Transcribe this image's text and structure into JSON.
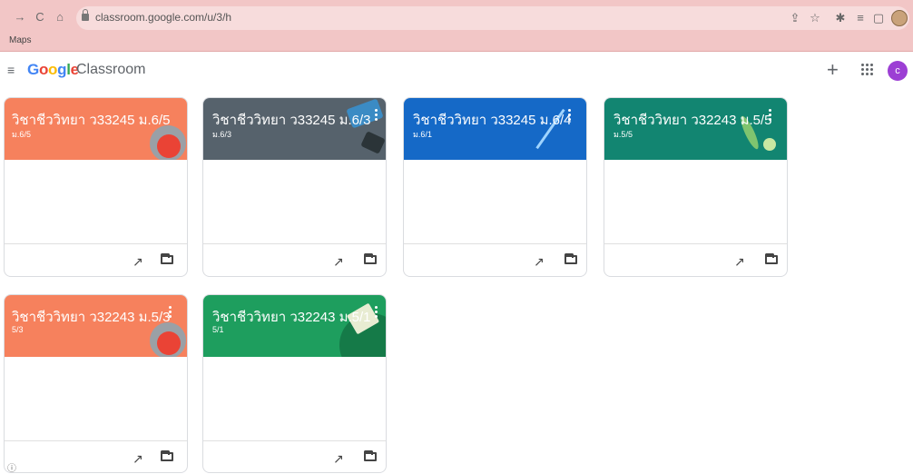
{
  "browser": {
    "url": "classroom.google.com/u/3/h",
    "bookmark": "Maps"
  },
  "app": {
    "logo_parts": [
      "G",
      "o",
      "o",
      "g",
      "l",
      "e"
    ],
    "product": "Classroom",
    "avatar_letter": "c"
  },
  "cards": [
    {
      "title": "วิชาชีววิทยา ว33245 ม.6/5",
      "subtitle": "ม.6/5",
      "color": "#f6815d"
    },
    {
      "title": "วิชาชีววิทยา ว33245 ม.6/3",
      "subtitle": "ม.6/3",
      "color": "#56626c"
    },
    {
      "title": "วิชาชีววิทยา ว33245 ม.6/4",
      "subtitle": "ม.6/1",
      "color": "#1569c7"
    },
    {
      "title": "วิชาชีววิทยา ว32243 ม.5/5",
      "subtitle": "ม.5/5",
      "color": "#128571"
    },
    {
      "title": "วิชาชีววิทยา ว32243 ม.5/3",
      "subtitle": "5/3",
      "color": "#f6815d"
    },
    {
      "title": "วิชาชีววิทยา ว32243 ม.5/1",
      "subtitle": "5/1",
      "color": "#1e9e5e"
    }
  ],
  "icons": {
    "trend": "↗",
    "menu": "≡",
    "plus": "+"
  }
}
